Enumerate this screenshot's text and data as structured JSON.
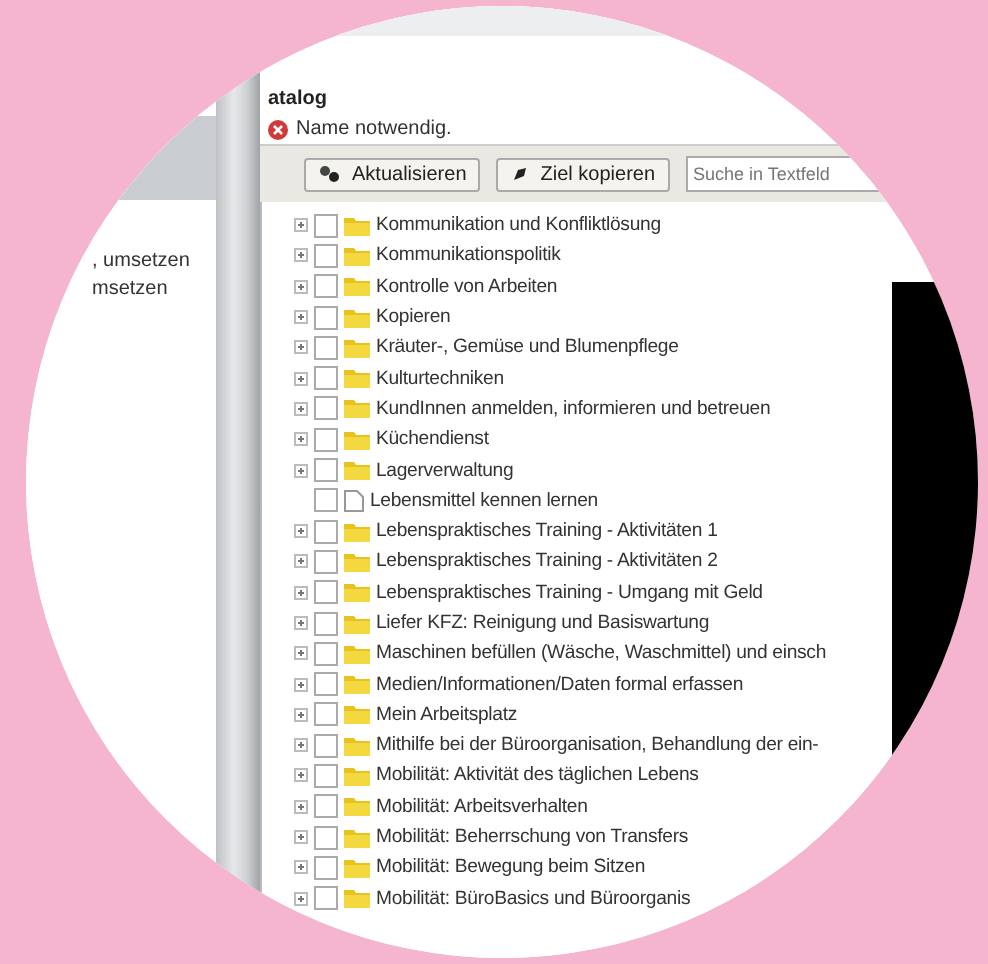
{
  "sidebar": {
    "lines": [
      ", umsetzen",
      "msetzen"
    ]
  },
  "header": {
    "title": "atalog",
    "error": "Name notwendig."
  },
  "toolbar": {
    "buttons": [
      "Aktualisieren",
      "Ziel kopieren"
    ],
    "search": {
      "placeholder": "Suche in Textfeld"
    }
  },
  "tree": {
    "items": [
      {
        "kind": "folder",
        "label": "Kommunikation und Konfliktlösung",
        "checked": false
      },
      {
        "kind": "folder",
        "label": "Kommunikationspolitik",
        "checked": false
      },
      {
        "kind": "folder",
        "label": "Kontrolle von Arbeiten",
        "checked": false
      },
      {
        "kind": "folder",
        "label": "Kopieren",
        "checked": false
      },
      {
        "kind": "folder",
        "label": "Kräuter-, Gemüse und Blumenpflege",
        "checked": false
      },
      {
        "kind": "folder",
        "label": "Kulturtechniken",
        "checked": false
      },
      {
        "kind": "folder",
        "label": "KundInnen anmelden, informieren und betreuen",
        "checked": false
      },
      {
        "kind": "folder",
        "label": "Küchendienst",
        "checked": false
      },
      {
        "kind": "folder",
        "label": "Lagerverwaltung",
        "checked": false
      },
      {
        "kind": "document",
        "label": "Lebensmittel kennen lernen",
        "checked": false
      },
      {
        "kind": "folder",
        "label": "Lebenspraktisches Training - Aktivitäten 1",
        "checked": false
      },
      {
        "kind": "folder",
        "label": "Lebenspraktisches Training - Aktivitäten 2",
        "checked": false
      },
      {
        "kind": "folder",
        "label": "Lebenspraktisches Training - Umgang mit Geld",
        "checked": false
      },
      {
        "kind": "folder",
        "label": "Liefer KFZ: Reinigung und Basiswartung",
        "checked": false
      },
      {
        "kind": "folder",
        "label": "Maschinen befüllen (Wäsche, Waschmittel) und einsch",
        "checked": false
      },
      {
        "kind": "folder",
        "label": "Medien/Informationen/Daten formal erfassen",
        "checked": false
      },
      {
        "kind": "folder",
        "label": "Mein Arbeitsplatz",
        "checked": false
      },
      {
        "kind": "folder",
        "label": "Mithilfe bei der Büroorganisation, Behandlung der ein-",
        "checked": false
      },
      {
        "kind": "folder",
        "label": "Mobilität: Aktivität des täglichen Lebens",
        "checked": false
      },
      {
        "kind": "folder",
        "label": "Mobilität: Arbeitsverhalten",
        "checked": false
      },
      {
        "kind": "folder",
        "label": "Mobilität: Beherrschung von Transfers",
        "checked": false
      },
      {
        "kind": "folder",
        "label": "Mobilität: Bewegung beim Sitzen",
        "checked": false
      },
      {
        "kind": "folder",
        "label": "Mobilität: BüroBasics und Büroorganis",
        "checked": false
      }
    ]
  }
}
